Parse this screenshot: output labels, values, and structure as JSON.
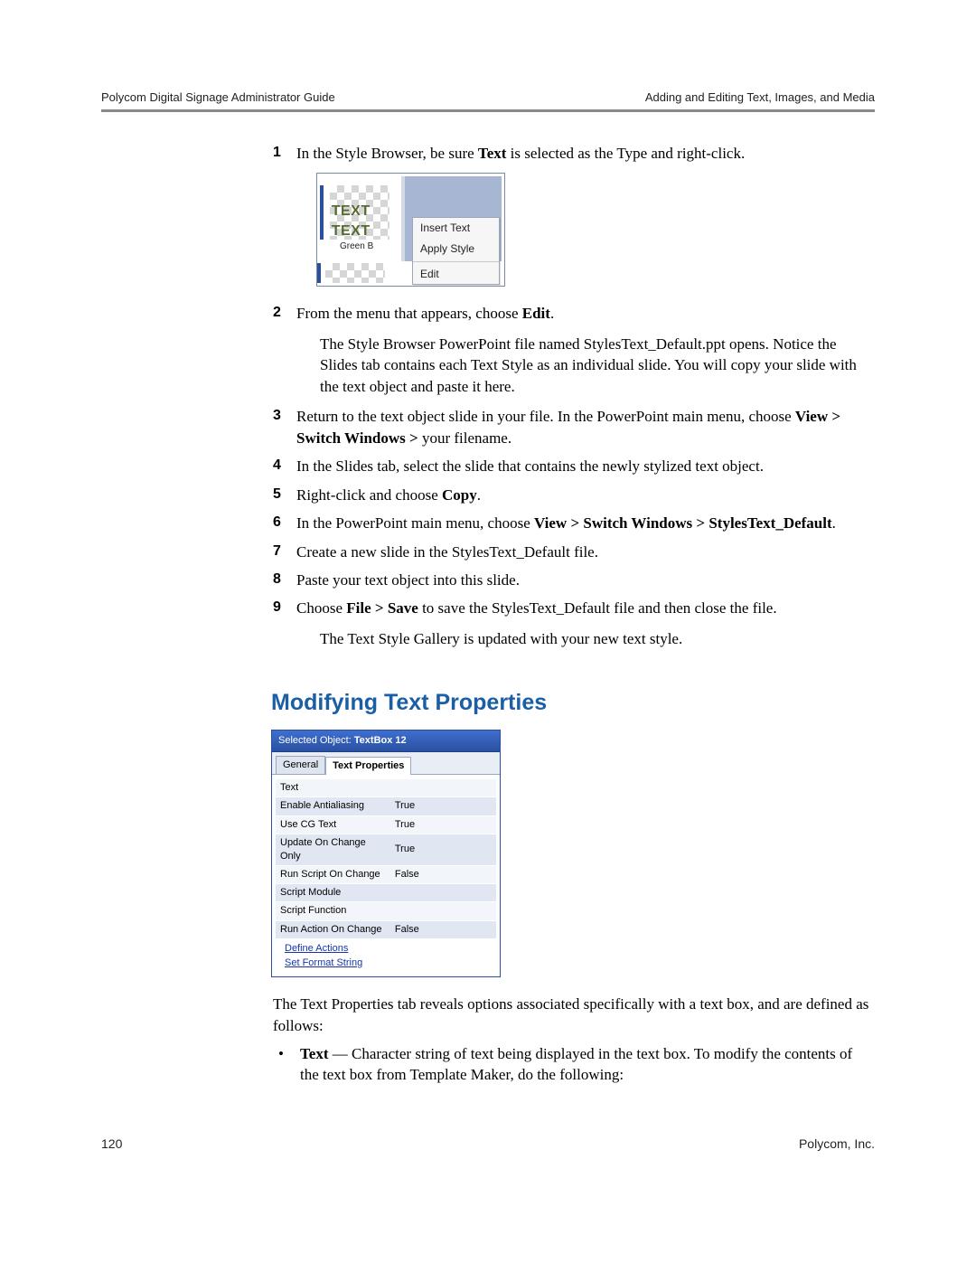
{
  "header": {
    "left": "Polycom Digital Signage Administrator Guide",
    "right": "Adding and Editing Text, Images, and Media"
  },
  "steps": [
    {
      "num": "1",
      "parts": [
        {
          "t": "In the Style Browser, be sure "
        },
        {
          "t": "Text",
          "b": true
        },
        {
          "t": " is selected as the Type and right-click."
        }
      ]
    },
    {
      "num": "2",
      "parts": [
        {
          "t": "From the menu that appears, choose "
        },
        {
          "t": "Edit",
          "b": true
        },
        {
          "t": "."
        }
      ],
      "after": "The Style Browser PowerPoint file named StylesText_Default.ppt opens. Notice the Slides tab contains each Text Style as an individual slide. You will copy your slide with the text object and paste it here."
    },
    {
      "num": "3",
      "parts": [
        {
          "t": "Return to the text object slide in your file. In the PowerPoint main menu, choose "
        },
        {
          "t": "View > Switch Windows > ",
          "b": true
        },
        {
          "t": "your filename."
        }
      ]
    },
    {
      "num": "4",
      "parts": [
        {
          "t": "In the Slides tab, select the slide that contains the newly stylized text object."
        }
      ]
    },
    {
      "num": "5",
      "parts": [
        {
          "t": "Right-click and choose "
        },
        {
          "t": "Copy",
          "b": true
        },
        {
          "t": "."
        }
      ]
    },
    {
      "num": "6",
      "parts": [
        {
          "t": "In the PowerPoint main menu, choose "
        },
        {
          "t": "View > Switch Windows > StylesText_Default",
          "b": true
        },
        {
          "t": "."
        }
      ]
    },
    {
      "num": "7",
      "parts": [
        {
          "t": "Create a new slide in the StylesText_Default file."
        }
      ]
    },
    {
      "num": "8",
      "parts": [
        {
          "t": "Paste your text object into this slide."
        }
      ]
    },
    {
      "num": "9",
      "parts": [
        {
          "t": "Choose "
        },
        {
          "t": "File > Save",
          "b": true
        },
        {
          "t": " to save the StylesText_Default file and then close the file."
        }
      ],
      "after": "The Text Style Gallery is updated with your new text style."
    }
  ],
  "fig1": {
    "swatch_text": "TEXT TEXT",
    "swatch_caption": "Green B",
    "menu": {
      "insert": "Insert Text",
      "apply": "Apply Style",
      "edit": "Edit"
    }
  },
  "section_heading": "Modifying Text Properties",
  "panel": {
    "selected_label": "Selected Object:",
    "selected_value": "TextBox 12",
    "tabs": {
      "general": "General",
      "textprops": "Text Properties"
    },
    "rows": [
      {
        "k": "Text",
        "v": ""
      },
      {
        "k": "Enable Antialiasing",
        "v": "True"
      },
      {
        "k": "Use CG Text",
        "v": "True"
      },
      {
        "k": "Update On Change Only",
        "v": "True"
      },
      {
        "k": "Run Script On Change",
        "v": "False"
      },
      {
        "k": "Script Module",
        "v": ""
      },
      {
        "k": "Script Function",
        "v": ""
      },
      {
        "k": "Run Action On Change",
        "v": "False"
      }
    ],
    "links": {
      "define": "Define Actions",
      "format": "Set Format String"
    }
  },
  "post_panel_text": "The Text Properties tab reveals options associated specifically with a text box, and are defined as follows:",
  "bullets": [
    {
      "parts": [
        {
          "t": "Text",
          "b": true
        },
        {
          "t": " — Character string of text being displayed in the text box. To modify the contents of the text box from Template Maker, do the following:"
        }
      ]
    }
  ],
  "footer": {
    "page": "120",
    "company": "Polycom, Inc."
  }
}
